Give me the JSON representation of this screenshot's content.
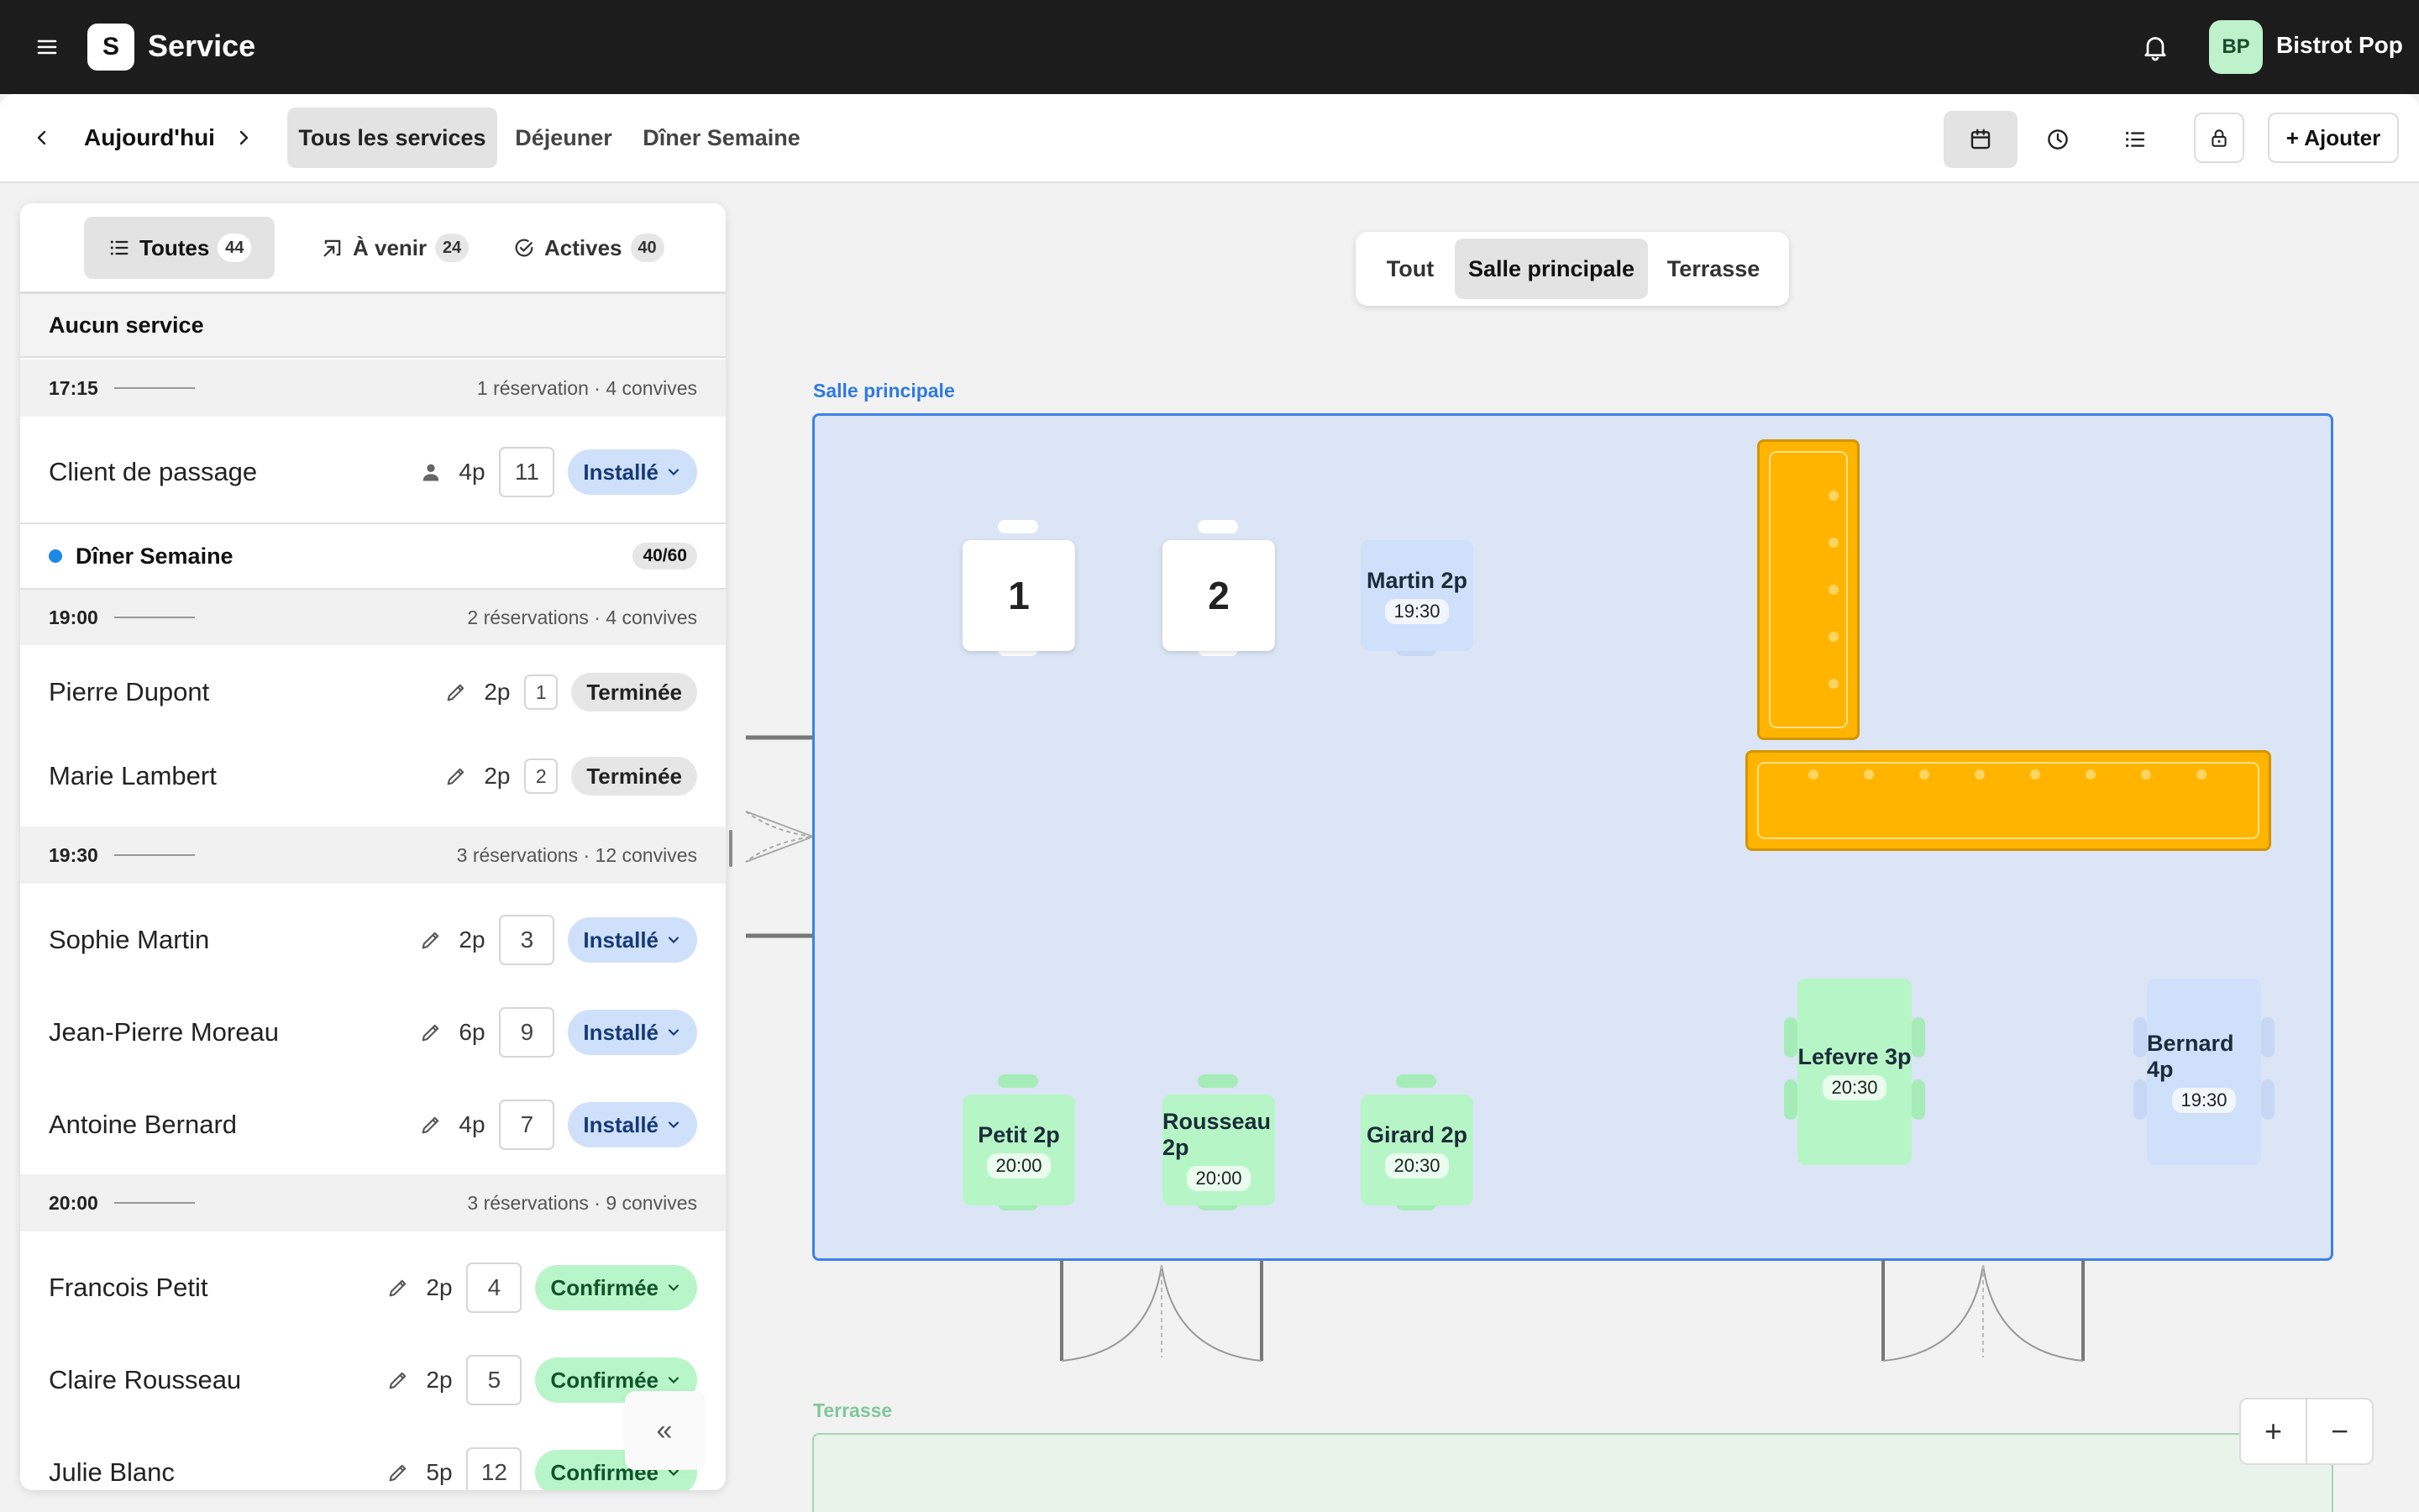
{
  "app": {
    "logo_letter": "S",
    "title": "Service"
  },
  "account": {
    "initials": "BP",
    "name": "Bistrot Pop"
  },
  "header": {
    "date": "Aujourd'hui",
    "services": [
      "Tous les services",
      "Déjeuner",
      "Dîner Semaine"
    ],
    "add_label": "+ Ajouter"
  },
  "filters": [
    {
      "label": "Toutes",
      "count": "44"
    },
    {
      "label": "À venir",
      "count": "24"
    },
    {
      "label": "Actives",
      "count": "40"
    }
  ],
  "list": {
    "no_service": "Aucun service",
    "slot1": {
      "time": "17:15",
      "summary": "1 réservation · 4 convives"
    },
    "walkin": {
      "name": "Client de passage",
      "covers": "4p",
      "table": "11",
      "status": "Installé"
    },
    "service": {
      "name": "Dîner Semaine",
      "capacity": "40/60"
    },
    "slot2": {
      "time": "19:00",
      "summary": "2 réservations · 4 convives"
    },
    "r1": {
      "name": "Pierre Dupont",
      "covers": "2p",
      "table": "1",
      "status": "Terminée"
    },
    "r2": {
      "name": "Marie Lambert",
      "covers": "2p",
      "table": "2",
      "status": "Terminée"
    },
    "slot3": {
      "time": "19:30",
      "summary": "3 réservations · 12 convives"
    },
    "r3": {
      "name": "Sophie Martin",
      "covers": "2p",
      "table": "3",
      "status": "Installé"
    },
    "r4": {
      "name": "Jean-Pierre Moreau",
      "covers": "6p",
      "table": "9",
      "status": "Installé"
    },
    "r5": {
      "name": "Antoine Bernard",
      "covers": "4p",
      "table": "7",
      "status": "Installé"
    },
    "slot4": {
      "time": "20:00",
      "summary": "3 réservations · 9 convives"
    },
    "r6": {
      "name": "Francois Petit",
      "covers": "2p",
      "table": "4",
      "status": "Confirmée"
    },
    "r7": {
      "name": "Claire Rousseau",
      "covers": "2p",
      "table": "5",
      "status": "Confirmée"
    },
    "r8": {
      "name": "Julie Blanc",
      "covers": "5p",
      "table": "12",
      "status": "Confirmée"
    },
    "collapse": "«"
  },
  "zones": [
    "Tout",
    "Salle principale",
    "Terrasse"
  ],
  "floor": {
    "room_label": "Salle principale",
    "terrace_label": "Terrasse",
    "t1": {
      "num": "1"
    },
    "t2": {
      "num": "2"
    },
    "t_martin": {
      "name": "Martin 2p",
      "time": "19:30"
    },
    "t_petit": {
      "name": "Petit 2p",
      "time": "20:00"
    },
    "t_rousseau": {
      "name": "Rousseau 2p",
      "time": "20:00"
    },
    "t_girard": {
      "name": "Girard 2p",
      "time": "20:30"
    },
    "t_lefevre": {
      "name": "Lefevre 3p",
      "time": "20:30"
    },
    "t_bernard": {
      "name": "Bernard 4p",
      "time": "19:30"
    }
  },
  "zoom": {
    "in": "+",
    "out": "−"
  },
  "colors": {
    "room_blue": "#3c82e6",
    "seated": "#cfe0fb",
    "confirmed": "#b6f6c6",
    "bar": "#ffb400",
    "terrace_label": "#7fc79a"
  }
}
